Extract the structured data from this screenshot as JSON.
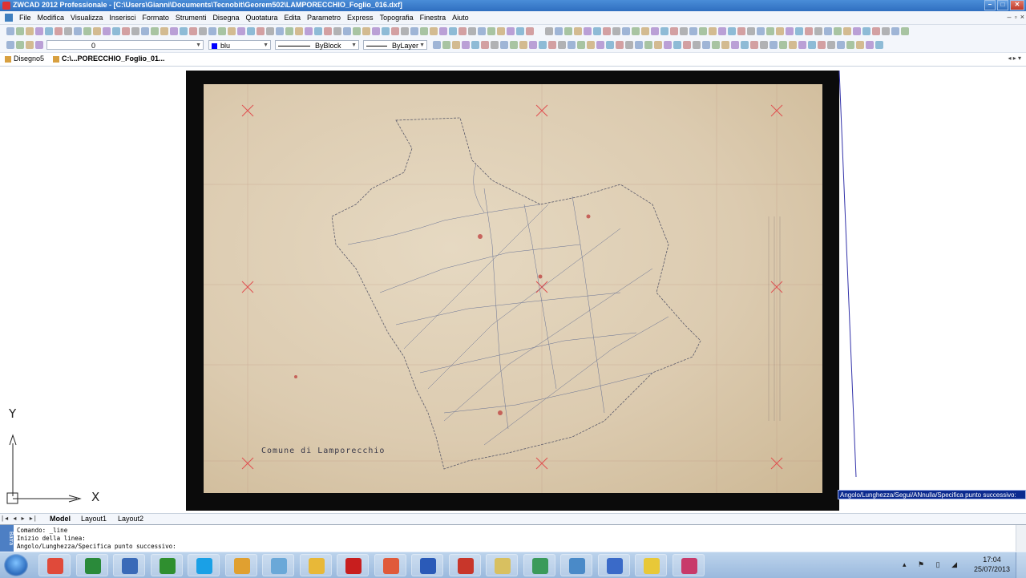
{
  "window": {
    "title": "ZWCAD 2012 Professionale - [C:\\Users\\Gianni\\Documents\\Tecnobit\\Georem502\\LAMPORECCHIO_Foglio_016.dxf]",
    "minimize": "–",
    "maximize": "□",
    "close": "✕"
  },
  "menu": {
    "items": [
      "File",
      "Modifica",
      "Visualizza",
      "Inserisci",
      "Formato",
      "Strumenti",
      "Disegna",
      "Quotatura",
      "Edita",
      "Parametro",
      "Express",
      "Topografia",
      "Finestra",
      "Aiuto"
    ],
    "doc_minimize": "–",
    "doc_restore": "▫",
    "doc_close": "×"
  },
  "properties": {
    "layer": "0",
    "color": "blu",
    "color_hex": "#0000ff",
    "linetype": "ByBlock",
    "lineweight": "ByLayer"
  },
  "doc_tabs": [
    {
      "label": "Disegno5"
    },
    {
      "label": "C:\\...PORECCHIO_Foglio_01..."
    }
  ],
  "tab_nav": "◂ ▸ ▾",
  "drawing": {
    "map_title": "Comune  di  Lamporecchio",
    "ucs_x": "X",
    "ucs_y": "Y",
    "tooltip": "Angolo/Lunghezza/Segui/ANnulla/Specifica punto successivo:"
  },
  "layout_tabs": {
    "nav": "|◂ ◂ ▸ ▸|",
    "items": [
      "Model",
      "Layout1",
      "Layout2"
    ],
    "active": "Model"
  },
  "command": {
    "side_label": "Barra",
    "lines": [
      "Comando: _line",
      "Inizio della linea:",
      "Angolo/Lunghezza/Specifica punto successivo:"
    ]
  },
  "taskbar": {
    "apps": [
      {
        "name": "chrome-icon",
        "color": "#e04a3a"
      },
      {
        "name": "download-icon",
        "color": "#2a8a3a"
      },
      {
        "name": "search-app-icon",
        "color": "#3a6ab8"
      },
      {
        "name": "map-green-icon",
        "color": "#2f8f2f"
      },
      {
        "name": "skype-icon",
        "color": "#1aa0e6"
      },
      {
        "name": "mail-icon",
        "color": "#e0a030"
      },
      {
        "name": "paper-icon",
        "color": "#6aa8d8"
      },
      {
        "name": "folder-icon",
        "color": "#e8b838"
      },
      {
        "name": "pdf-icon",
        "color": "#c81e1e"
      },
      {
        "name": "paint-icon",
        "color": "#e05a3a"
      },
      {
        "name": "word-icon",
        "color": "#2a5ab8"
      },
      {
        "name": "zwcad-icon",
        "color": "#c8362a"
      },
      {
        "name": "notes-icon",
        "color": "#d8c060"
      },
      {
        "name": "topo-icon",
        "color": "#3a9a5a"
      },
      {
        "name": "window-icon",
        "color": "#4a8ac8"
      },
      {
        "name": "gear-app-icon",
        "color": "#3a6ac8"
      },
      {
        "name": "help-icon",
        "color": "#e8c838"
      },
      {
        "name": "tools-icon",
        "color": "#c83a6a"
      }
    ],
    "tray": "▴ ⚑ ▯ ◢",
    "time": "17:04",
    "date": "25/07/2013"
  }
}
